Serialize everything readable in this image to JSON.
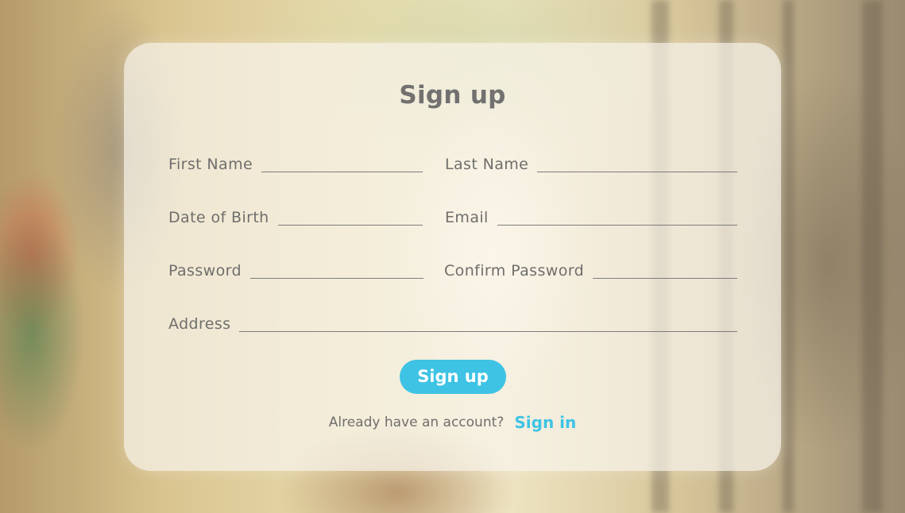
{
  "form": {
    "title": "Sign up",
    "fields": {
      "first_name": {
        "label": "First Name",
        "value": ""
      },
      "last_name": {
        "label": "Last Name",
        "value": ""
      },
      "date_of_birth": {
        "label": "Date of Birth",
        "value": ""
      },
      "email": {
        "label": "Email",
        "value": ""
      },
      "password": {
        "label": "Password",
        "value": ""
      },
      "confirm_password": {
        "label": "Confirm Password",
        "value": ""
      },
      "address": {
        "label": "Address",
        "value": ""
      }
    },
    "submit_label": "Sign up",
    "footer": {
      "question": "Already have an account?",
      "link_label": "Sign in"
    }
  },
  "colors": {
    "accent": "#3ec3e4",
    "text": "#6f6e6c",
    "title": "#727170"
  }
}
